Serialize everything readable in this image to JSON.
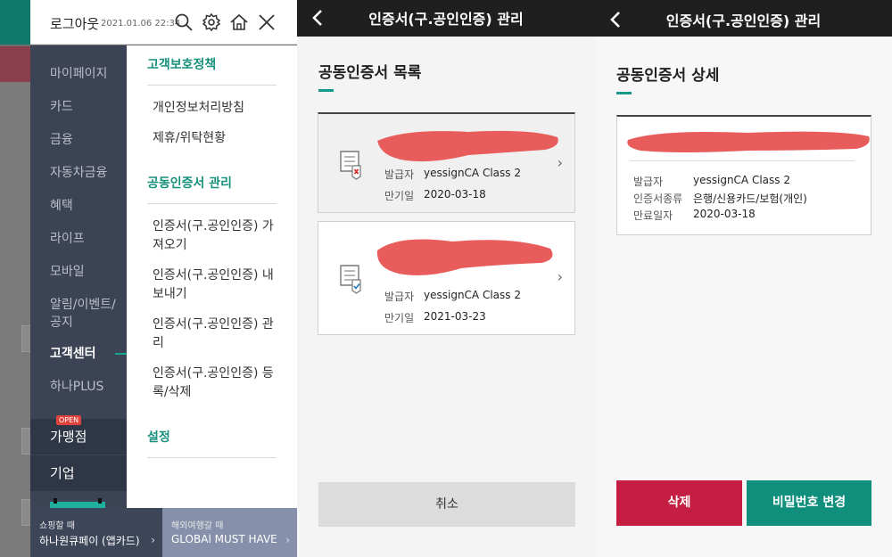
{
  "menu": {
    "logout": "로그아웃",
    "timestamp": "2021.01.06 22:34",
    "sidebar": [
      "마이페이지",
      "카드",
      "금융",
      "자동차금융",
      "혜택",
      "라이프",
      "모바일",
      "알림/이벤트/공지",
      "고객센터",
      "하나PLUS"
    ],
    "sidebar_extra": {
      "open_badge": "OPEN",
      "merchant": "가맹점",
      "corporate": "기업"
    },
    "content": {
      "section1": "고객보호정책",
      "section1_items": [
        "개인정보처리방침",
        "제휴/위탁현황"
      ],
      "section2": "공동인증서 관리",
      "section2_items": [
        "인증서(구.공인인증) 가져오기",
        "인증서(구.공인인증) 내보내기",
        "인증서(구.공인인증) 관리",
        "인증서(구.공인인증) 등록/삭제"
      ],
      "section3": "설정"
    },
    "banners": [
      {
        "small": "쇼핑할 때",
        "big": "하나원큐페이 (앱카드)"
      },
      {
        "small": "해외여행갈 때",
        "big": "GLOBAl MUST HAVE"
      }
    ]
  },
  "list_screen": {
    "title": "인증서(구.공인인증) 관리",
    "section_title": "공동인증서 목록",
    "certs": [
      {
        "issuer_label": "발급자",
        "issuer": "yessignCA Class 2",
        "expiry_label": "만기일",
        "expiry": "2020-03-18",
        "status": "expired"
      },
      {
        "issuer_label": "발급자",
        "issuer": "yessignCA Class 2",
        "expiry_label": "만기일",
        "expiry": "2021-03-23",
        "status": "valid"
      }
    ],
    "cancel": "취소"
  },
  "detail_screen": {
    "title": "인증서(구.공인인증) 관리",
    "section_title": "공동인증서 상세",
    "fields": [
      {
        "label": "발급자",
        "value": "yessignCA Class 2"
      },
      {
        "label": "인증서종류",
        "value": "은행/신용카드/보험(개인)"
      },
      {
        "label": "만료일자",
        "value": "2020-03-18"
      }
    ],
    "delete": "삭제",
    "change_password": "비밀번호 변경"
  },
  "colors": {
    "accent_green": "#16988a",
    "delete_red": "#c41e42",
    "redaction": "#e85c5c",
    "sidebar_bg": "#3c4354"
  }
}
